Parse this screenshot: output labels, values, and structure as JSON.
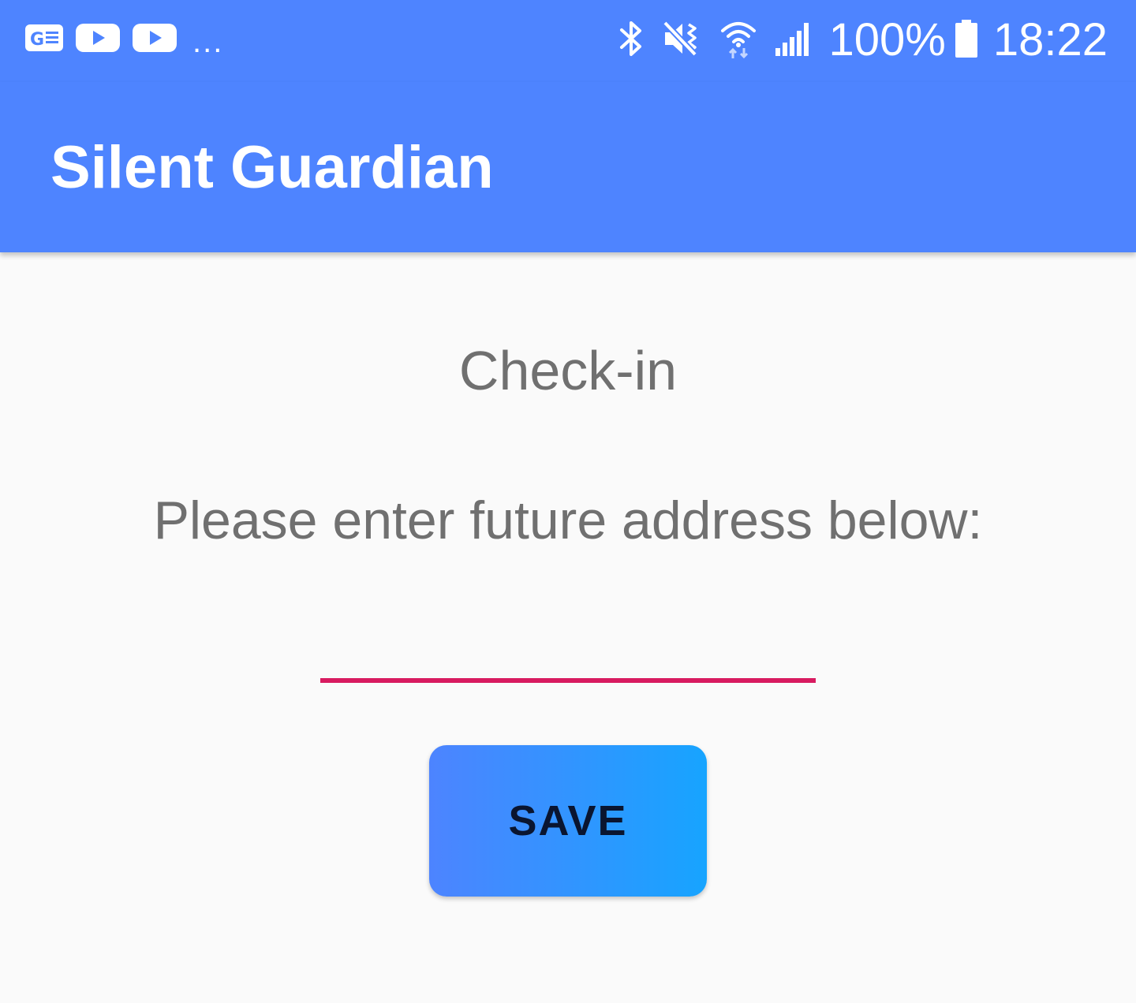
{
  "status_bar": {
    "notification_icons": [
      "news-icon",
      "youtube-icon",
      "youtube-icon"
    ],
    "more_indicator": "...",
    "status_icons": [
      "bluetooth-icon",
      "vibrate-mute-icon",
      "wifi-icon",
      "signal-icon"
    ],
    "battery_percent": "100%",
    "time": "18:22"
  },
  "app_bar": {
    "title": "Silent Guardian"
  },
  "main": {
    "heading": "Check-in",
    "prompt": "Please enter future address below:",
    "address_value": "",
    "save_label": "SAVE"
  },
  "colors": {
    "primary": "#4e84ff",
    "accent_underline": "#d81b60",
    "button_gradient_start": "#4d84ff",
    "button_gradient_end": "#17a4ff",
    "background": "#fafafa",
    "text_gray": "#707070"
  }
}
